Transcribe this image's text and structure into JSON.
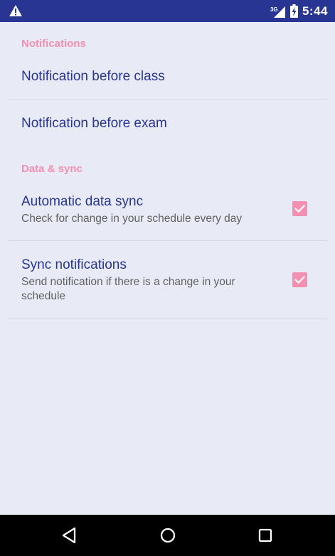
{
  "status_bar": {
    "network_type": "3G",
    "time": "5:44"
  },
  "sections": {
    "notifications_header": "Notifications",
    "data_sync_header": "Data & sync"
  },
  "prefs": {
    "before_class": {
      "title": "Notification before class"
    },
    "before_exam": {
      "title": "Notification before exam"
    },
    "auto_sync": {
      "title": "Automatic data sync",
      "summary": "Check for change in your schedule every day",
      "checked": true
    },
    "sync_notifications": {
      "title": "Sync notifications",
      "summary": "Send notification if there is a change in your schedule",
      "checked": true
    }
  },
  "colors": {
    "status_bar": "#283593",
    "background": "#e8eaf6",
    "accent": "#f48fb1",
    "title_text": "#283593",
    "summary_text": "#616161"
  },
  "icons": {
    "status_left": "warning-icon",
    "status_right": [
      "signal-icon",
      "battery-charging-icon"
    ],
    "navigation": [
      "back-icon",
      "home-icon",
      "recents-icon"
    ]
  }
}
